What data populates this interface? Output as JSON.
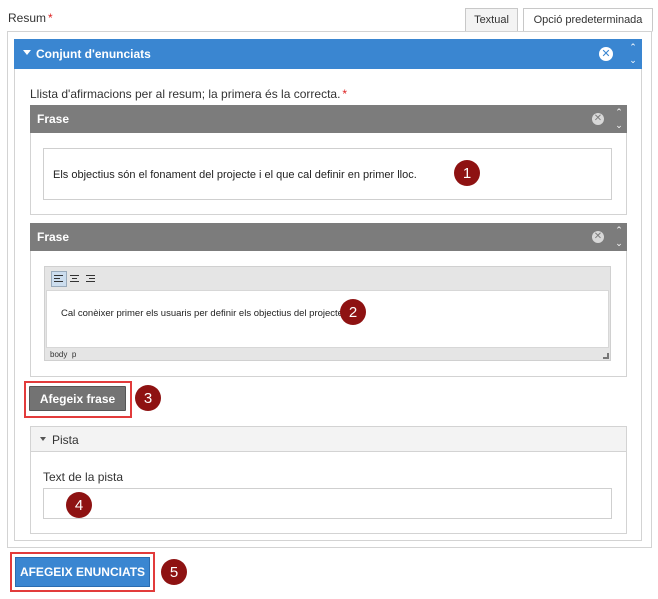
{
  "header": {
    "field_label": "Resum",
    "required_mark": "*",
    "tabs": [
      {
        "label": "Textual",
        "active": false
      },
      {
        "label": "Opció predeterminada",
        "active": true
      }
    ]
  },
  "group": {
    "title": "Conjunt d'enunciats",
    "description": "Llista d'afirmacions per al resum; la primera és la correcta.",
    "required_mark": "*"
  },
  "sentences": [
    {
      "title": "Frase",
      "text": "Els objectius són el fonament del projecte i el que cal definir en primer lloc."
    },
    {
      "title": "Frase",
      "text": "Cal conèixer primer els usuaris per definir els objectius del projecte.",
      "status": [
        "body",
        "p"
      ]
    }
  ],
  "buttons": {
    "add_sentence": "Afegeix frase",
    "add_statements": "AFEGEIX ENUNCIATS"
  },
  "hint": {
    "section_title": "Pista",
    "field_label": "Text de la pista",
    "value": ""
  },
  "callouts": [
    "1",
    "2",
    "3",
    "4",
    "5"
  ],
  "colors": {
    "accent_blue": "#3a86d1",
    "panel_gray": "#7c7c7c",
    "callout_red": "#8e1212",
    "highlight_red": "#e23b3b",
    "required_red": "#dd2222"
  }
}
